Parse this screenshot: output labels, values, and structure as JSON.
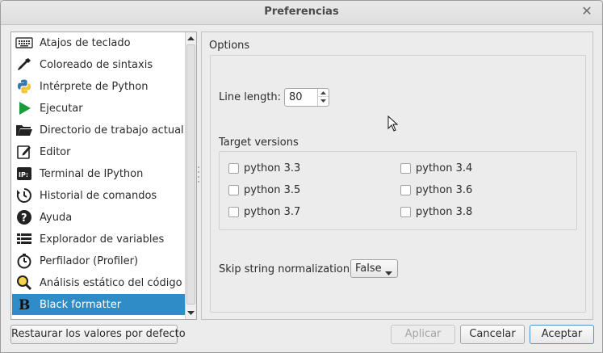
{
  "window": {
    "title": "Preferencias",
    "close_icon": "close-icon"
  },
  "sidebar": {
    "items": [
      {
        "label": "Atajos de teclado",
        "icon": "keyboard-icon"
      },
      {
        "label": "Coloreado de sintaxis",
        "icon": "eyedropper-icon"
      },
      {
        "label": "Intérprete de Python",
        "icon": "python-icon"
      },
      {
        "label": "Ejecutar",
        "icon": "play-icon"
      },
      {
        "label": "Directorio de trabajo actual",
        "icon": "folder-icon"
      },
      {
        "label": "Editor",
        "icon": "edit-icon"
      },
      {
        "label": "Terminal de IPython",
        "icon": "ipython-icon"
      },
      {
        "label": "Historial de comandos",
        "icon": "history-icon"
      },
      {
        "label": "Ayuda",
        "icon": "help-icon"
      },
      {
        "label": "Explorador de variables",
        "icon": "table-icon"
      },
      {
        "label": "Perfilador (Profiler)",
        "icon": "stopwatch-icon"
      },
      {
        "label": "Análisis estático del código",
        "icon": "magnifier-icon"
      },
      {
        "label": "Black formatter",
        "icon": "black-logo-icon"
      }
    ],
    "selected_index": 12
  },
  "panel": {
    "options_label": "Options",
    "line_length_label": "Line length:",
    "line_length_value": "80",
    "target_versions_label": "Target versions",
    "versions": [
      {
        "label": "python 3.3",
        "checked": false
      },
      {
        "label": "python 3.4",
        "checked": false
      },
      {
        "label": "python 3.5",
        "checked": false
      },
      {
        "label": "python 3.6",
        "checked": false
      },
      {
        "label": "python 3.7",
        "checked": false
      },
      {
        "label": "python 3.8",
        "checked": false
      }
    ],
    "skip_string_label": "Skip string normalization:",
    "skip_string_value": "False"
  },
  "buttons": {
    "reset": "Restaurar los valores por defecto",
    "apply": "Aplicar",
    "cancel": "Cancelar",
    "accept": "Aceptar"
  },
  "colors": {
    "selection": "#308cc6",
    "accent_border": "#4f8ed2"
  }
}
